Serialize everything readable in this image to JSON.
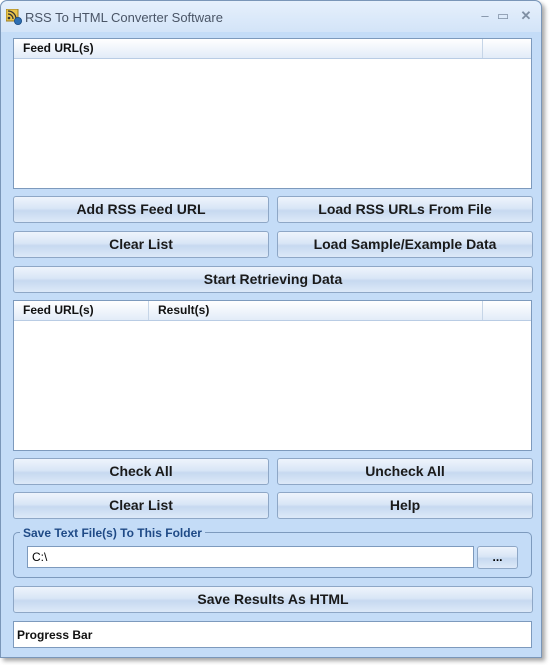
{
  "window": {
    "title": "RSS To HTML Converter Software",
    "icon": "rss-app-icon",
    "controls": {
      "minimize": "–",
      "maximize": "▭",
      "close": "✕"
    }
  },
  "feed_list": {
    "columns": [
      "Feed URL(s)",
      ""
    ],
    "rows": []
  },
  "buttons": {
    "add_rss_feed_url": "Add RSS Feed URL",
    "load_rss_urls_from_file": "Load RSS URLs From File",
    "clear_list_top": "Clear List",
    "load_sample_data": "Load Sample/Example Data",
    "start_retrieving": "Start Retrieving Data",
    "check_all": "Check All",
    "uncheck_all": "Uncheck All",
    "clear_list_bottom": "Clear List",
    "help": "Help",
    "browse": "...",
    "save_results_html": "Save Results As HTML"
  },
  "results_list": {
    "columns": [
      "Feed URL(s)",
      "Result(s)",
      ""
    ],
    "rows": []
  },
  "save_folder": {
    "label": "Save Text File(s) To This Folder",
    "value": "C:\\"
  },
  "progress": {
    "label": "Progress Bar",
    "percent": 0
  }
}
